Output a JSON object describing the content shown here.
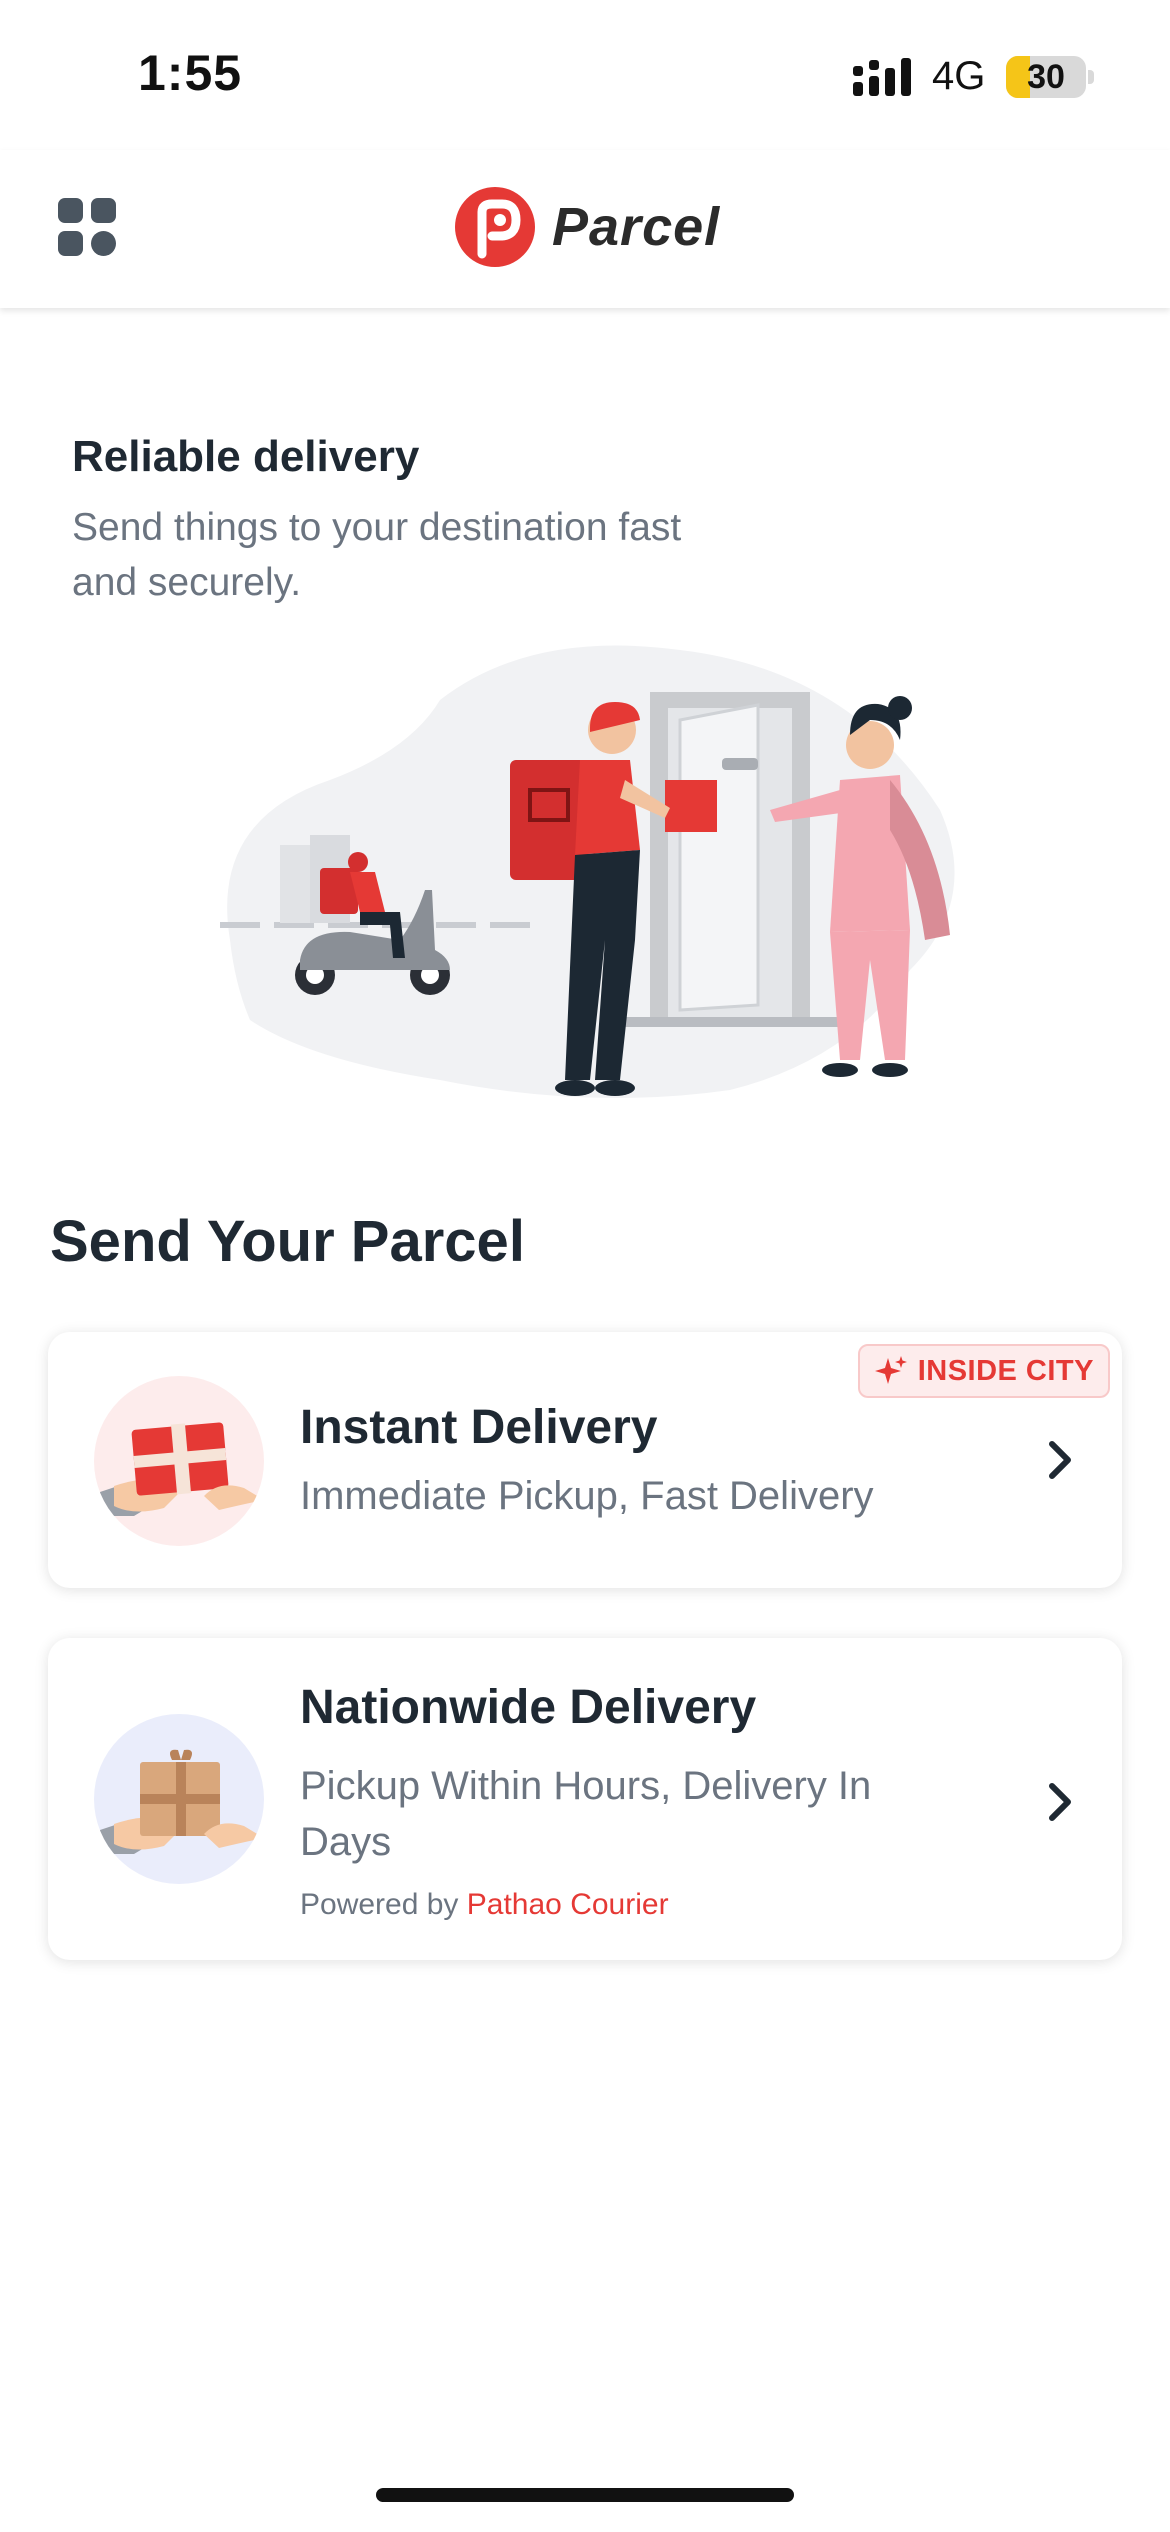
{
  "status_bar": {
    "time": "1:55",
    "network": "4G",
    "battery": "30",
    "battery_level_percent": 30
  },
  "header": {
    "brand_name": "Parcel",
    "menu_icon": "grid-menu-icon",
    "logo_icon": "parcel-logo-icon"
  },
  "hero": {
    "title": "Reliable delivery",
    "subtitle": "Send things to your destination fast and securely.",
    "illustration": "courier-delivery-illustration"
  },
  "section": {
    "title": "Send Your Parcel"
  },
  "cards": [
    {
      "title": "Instant Delivery",
      "subtitle": "Immediate Pickup, Fast Delivery",
      "badge": "INSIDE CITY",
      "icon": "gift-parcel-icon"
    },
    {
      "title": "Nationwide Delivery",
      "subtitle": "Pickup Within Hours, Delivery In Days",
      "powered_by_label": "Powered by",
      "powered_by_brand": "Pathao Courier",
      "icon": "box-parcel-icon"
    }
  ],
  "colors": {
    "brand_red": "#e53935",
    "text_dark": "#1f2933",
    "text_muted": "#6b7480",
    "instant_icon_bg": "#fdecec",
    "nationwide_icon_bg": "#eaedfb"
  }
}
